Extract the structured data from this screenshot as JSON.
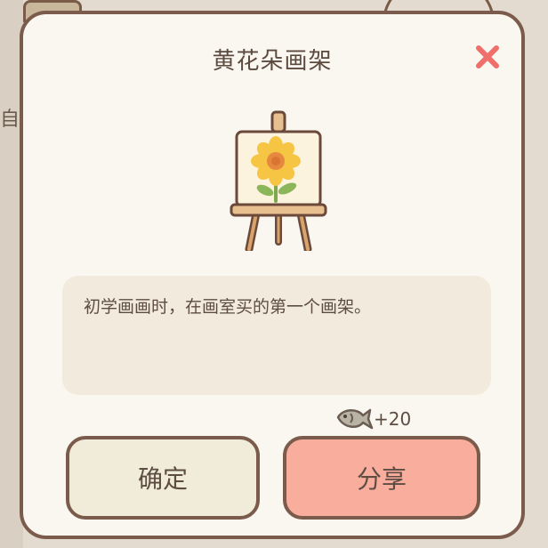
{
  "background": {
    "side_text": "自"
  },
  "dialog": {
    "title": "黄花朵画架",
    "close_icon": "close-x-icon",
    "item_icon": "sunflower-easel-icon",
    "description": "初学画画时，在画室买的第一个画架。",
    "reward": {
      "icon": "fish-icon",
      "value": "+20"
    },
    "buttons": {
      "confirm_label": "确定",
      "share_label": "分享"
    }
  },
  "colors": {
    "dialog_bg": "#faf7f1",
    "border": "#7b5b4c",
    "close": "#ef6f6a",
    "confirm_bg": "#f1ebd9",
    "share_bg": "#f8ad9d",
    "desc_bg": "#f2ebdd"
  }
}
